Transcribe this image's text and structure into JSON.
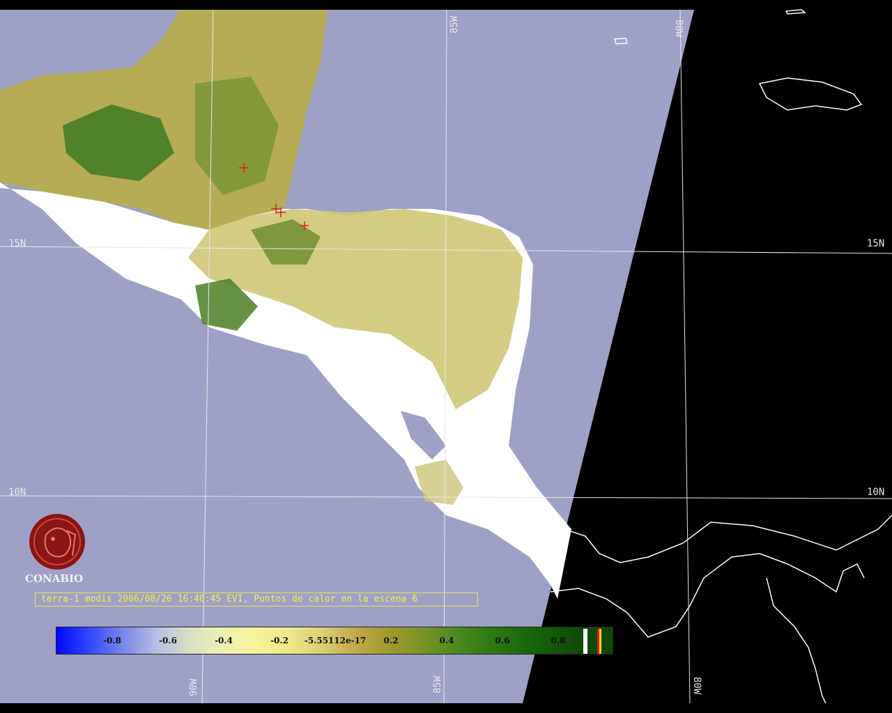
{
  "map": {
    "grid_labels": {
      "lat_15_left": "15N",
      "lat_15_right": "15N",
      "lat_10_left": "10N",
      "lat_10_right": "10N",
      "lon_85_top": "85W",
      "lon_80_top": "80W",
      "lon_90_bottom": "90W",
      "lon_85_bottom": "85W",
      "lon_80_bottom": "80W"
    },
    "colors": {
      "sea": "#9ea0c6",
      "night": "#000000",
      "cloud": "#ffffff",
      "grid": "#e8e8e8",
      "hotspot": "#e0201a"
    }
  },
  "logo": {
    "name": "CONABIO"
  },
  "caption": "terra-1 modis 2006/08/26 16:40:45 EVI, Puntos de calor en la escena 6",
  "legend": {
    "ticks": [
      "-0.8",
      "-0.6",
      "-0.4",
      "-0.2",
      "-5.55112e-17",
      "0.2",
      "0.4",
      "0.6",
      "0.8"
    ]
  }
}
